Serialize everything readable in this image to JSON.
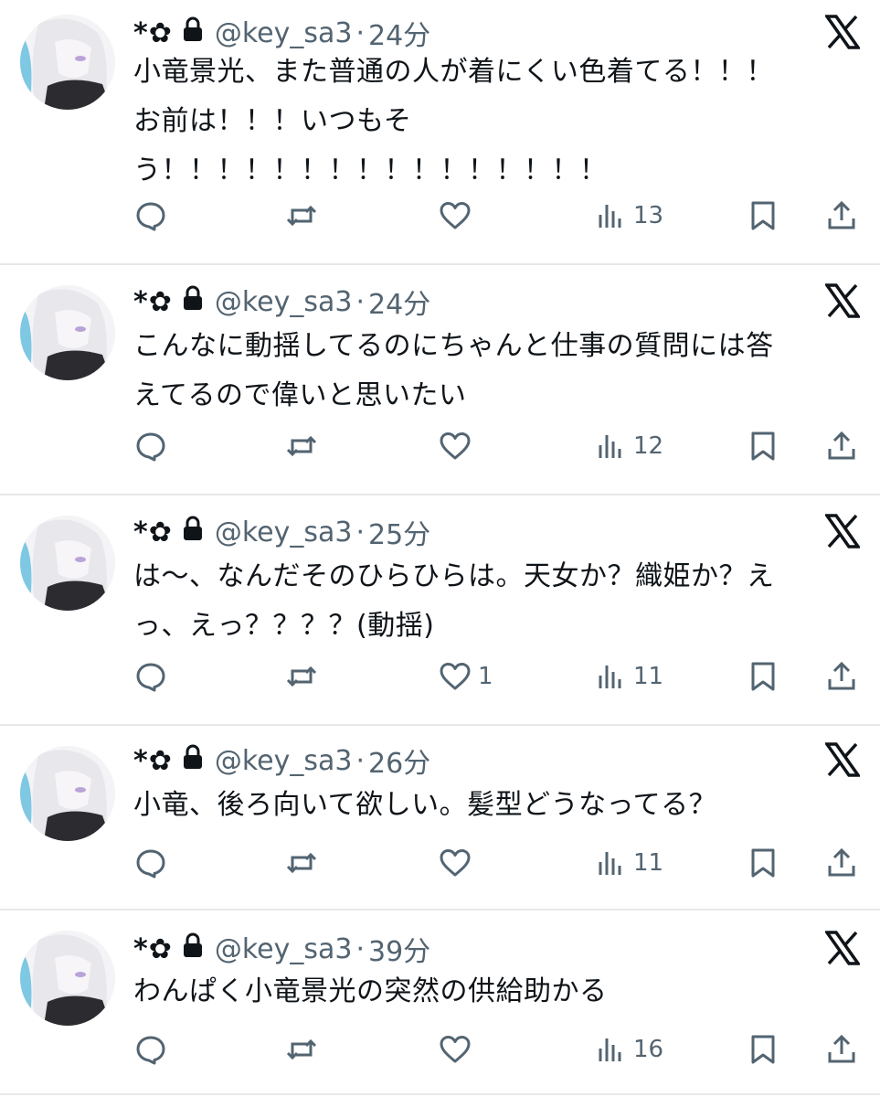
{
  "user": {
    "name": "*✿",
    "handle": "@key_sa3",
    "separator": "·"
  },
  "tweets": [
    {
      "time": "24分",
      "lines": [
        "小竜景光、また普通の人が着にくい色着てる！！！",
        "お前は！！！いつもそ",
        "う！！！！！！！！！！！！！！！！"
      ],
      "likes": "",
      "views": "13"
    },
    {
      "time": "24分",
      "lines": [
        "こんなに動揺してるのにちゃんと仕事の質問には答",
        "えてるので偉いと思いたい"
      ],
      "likes": "",
      "views": "12"
    },
    {
      "time": "25分",
      "lines": [
        "は〜、なんだそのひらひらは。天女か？織姫か？え",
        "っ、えっ？？？？(動揺)"
      ],
      "likes": "1",
      "views": "11"
    },
    {
      "time": "26分",
      "lines": [
        "小竜、後ろ向いて欲しい。髪型どうなってる？"
      ],
      "likes": "",
      "views": "11"
    },
    {
      "time": "39分",
      "lines": [
        "わんぱく小竜景光の突然の供給助かる"
      ],
      "likes": "",
      "views": "16"
    }
  ],
  "icons": {
    "reply": "speech-bubble-icon",
    "retweet": "retweet-icon",
    "like": "heart-icon",
    "views": "bar-chart-icon",
    "bookmark": "bookmark-icon",
    "share": "share-icon",
    "lock": "lock-icon",
    "platform": "x-logo-icon"
  },
  "colors": {
    "text": "#0f1419",
    "secondary": "#536471",
    "divider": "#e6e8ea"
  }
}
